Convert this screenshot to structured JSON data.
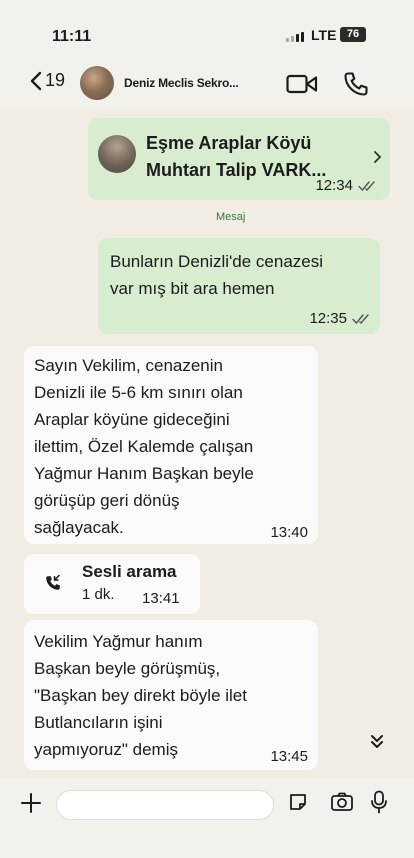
{
  "status_bar": {
    "time": "11:11",
    "network": "LTE",
    "battery": "76"
  },
  "header": {
    "back_count": "19",
    "contact_name": "Deniz Meclis Sekro..."
  },
  "messages": {
    "forwarded_contact": {
      "name_line1": "Eşme Araplar Köyü",
      "name_line2": "Muhtarı Talip VARK...",
      "time": "12:34"
    },
    "system_label": "Mesaj",
    "out_message": {
      "line1": "Bunların Denizli'de cenazesi",
      "line2": "var mış bit ara hemen",
      "time": "12:35"
    },
    "in_message_1": {
      "lines": [
        "Sayın Vekilim, cenazenin",
        "Denizli ile 5-6 km sınırı olan",
        "Araplar köyüne gideceğini",
        "ilettim, Özel Kalemde çalışan",
        "Yağmur Hanım Başkan beyle",
        "görüşüp geri dönüş",
        "sağlayacak."
      ],
      "time": "13:40"
    },
    "call": {
      "title": "Sesli arama",
      "duration": "1 dk.",
      "time": "13:41"
    },
    "in_message_2": {
      "lines": [
        "Vekilim Yağmur hanım",
        "Başkan beyle görüşmüş,",
        "\"Başkan bey direkt böyle ilet",
        "Butlancıların işini",
        "yapmıyoruz\" demiş"
      ],
      "time": "13:45"
    }
  },
  "composer": {
    "placeholder": ""
  },
  "icons": {
    "back": "chevron-left-icon",
    "video": "video-camera-icon",
    "phone": "phone-icon",
    "read": "double-check-icon",
    "call": "phone-incoming-icon",
    "scroll": "double-chevron-down-icon",
    "plus": "plus-icon",
    "sticker": "sticker-icon",
    "camera": "camera-icon",
    "mic": "microphone-icon"
  },
  "colors": {
    "outgoing_bubble": "#d8ecd0",
    "incoming_bubble": "#fbfaf8",
    "chat_background": "#f2ede4",
    "accent_green": "#2e7d3c"
  }
}
